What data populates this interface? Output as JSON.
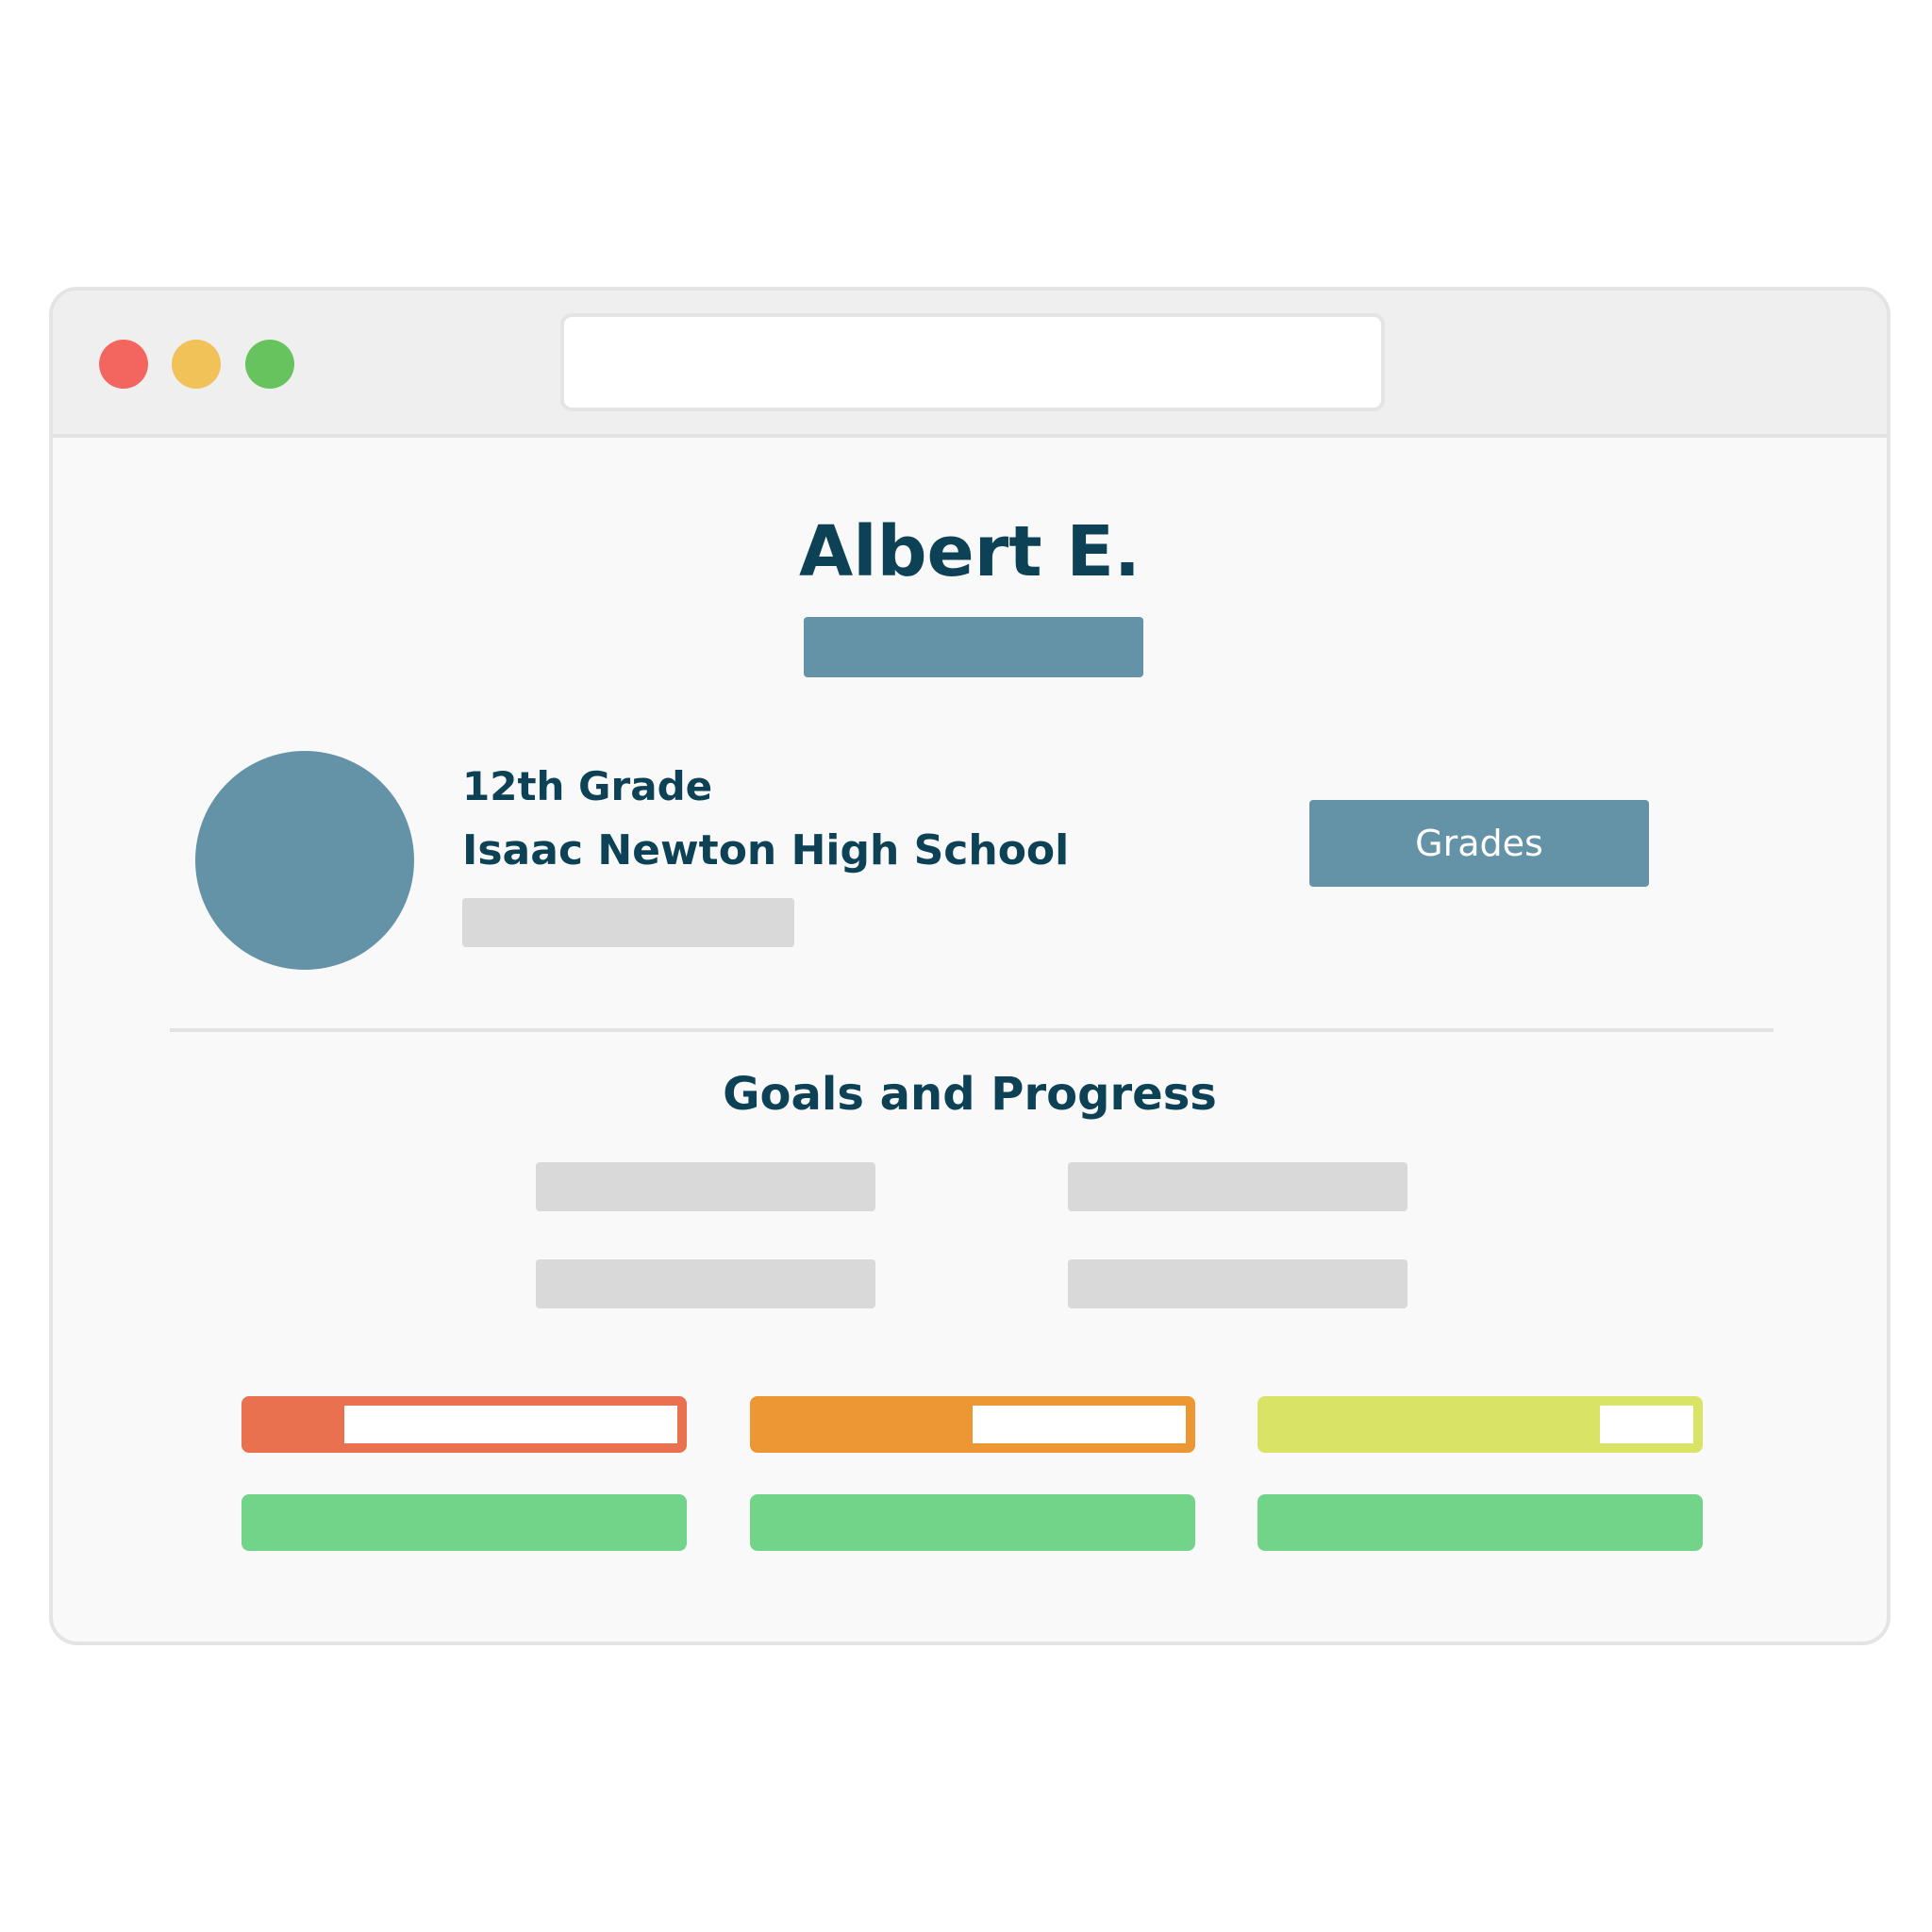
{
  "colors": {
    "window_red": "#f2665f",
    "window_yellow": "#f0c257",
    "window_green": "#67c35d",
    "accent": "#6493a8",
    "text_dark": "#0d4256",
    "placeholder_gray": "#d9d9d9",
    "progress_red": "#ea7150",
    "progress_orange": "#ed9634",
    "progress_yellow": "#d9e467",
    "bar_green": "#72d489"
  },
  "window": {
    "controls": [
      {
        "name": "close",
        "color": "#f2665f"
      },
      {
        "name": "minimize",
        "color": "#f0c257"
      },
      {
        "name": "maximize",
        "color": "#67c35d"
      }
    ]
  },
  "profile": {
    "name": "Albert E.",
    "grade": "12th Grade",
    "school": "Isaac Newton High School",
    "grades_button_label": "Grades"
  },
  "goals": {
    "title": "Goals and Progress",
    "progress_bars": [
      {
        "fill_fraction": 0.22,
        "color": "#ea7150"
      },
      {
        "fill_fraction": 0.5,
        "color": "#ed9634"
      },
      {
        "fill_fraction": 0.78,
        "color": "#d9e467"
      }
    ],
    "completed_bars": [
      {
        "color": "#72d489"
      },
      {
        "color": "#72d489"
      },
      {
        "color": "#72d489"
      }
    ]
  }
}
